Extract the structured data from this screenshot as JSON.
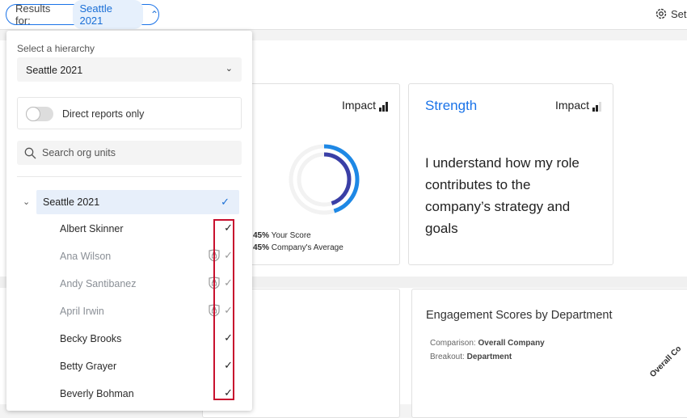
{
  "topbar": {
    "results_label": "Results for:",
    "results_value": "Seattle 2021",
    "settings_label": "Set"
  },
  "cards": {
    "card1": {
      "impact_label": "Impact",
      "legend": [
        {
          "value": "45%",
          "label": "Your Score"
        },
        {
          "value": "45%",
          "label": "Company's Average"
        }
      ],
      "your_score": 0.45,
      "company_average": 0.45
    },
    "card2": {
      "title": "Strength",
      "impact_label": "Impact",
      "statement": "I understand how my role contributes to the company’s strategy and goals"
    },
    "card4": {
      "title": "Engagement Scores by Department",
      "comparison_label": "Comparison:",
      "comparison_value": "Overall Company",
      "breakout_label": "Breakout:",
      "breakout_value": "Department",
      "column_header": "Overall Co"
    }
  },
  "panel": {
    "hierarchy_label": "Select a hierarchy",
    "hierarchy_value": "Seattle 2021",
    "toggle_label": "Direct reports only",
    "toggle_on": false,
    "search_placeholder": "Search org units",
    "root": {
      "label": "Seattle 2021",
      "checked": true
    },
    "items": [
      {
        "label": "Albert Skinner",
        "disabled": false
      },
      {
        "label": "Ana Wilson",
        "disabled": true
      },
      {
        "label": "Andy Santibanez",
        "disabled": true
      },
      {
        "label": "April Irwin",
        "disabled": true
      },
      {
        "label": "Becky Brooks",
        "disabled": false
      },
      {
        "label": "Betty Grayer",
        "disabled": false
      },
      {
        "label": "Beverly Bohman",
        "disabled": false
      }
    ]
  },
  "colors": {
    "accent": "#1a73e8",
    "highlight": "#c8102e",
    "score_dark": "#3a3fa6",
    "score_light": "#1e88e5"
  }
}
